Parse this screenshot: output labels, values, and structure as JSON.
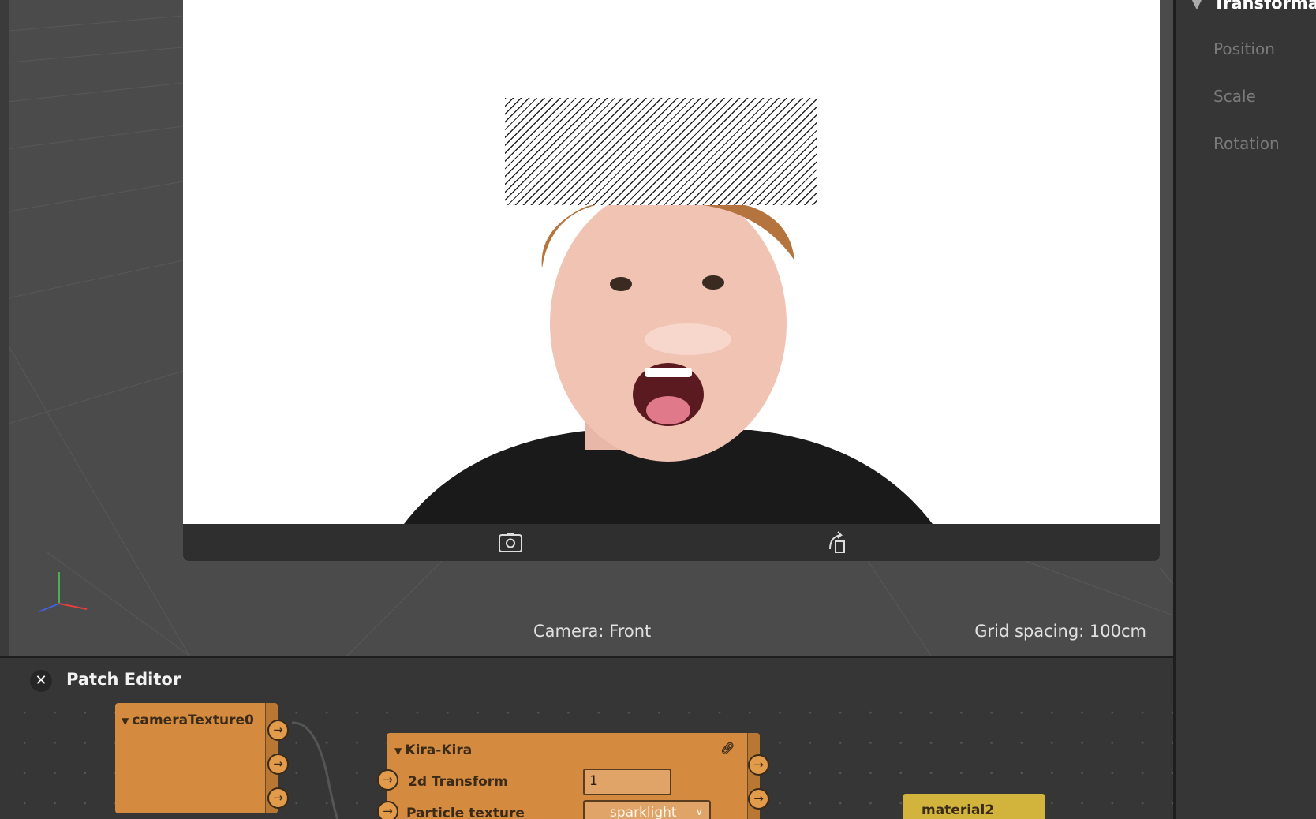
{
  "viewport": {
    "camera_label": "Camera: Front",
    "grid_spacing_label": "Grid spacing: 100cm",
    "toolbar_icons": [
      "flip-camera-icon",
      "rotate-device-icon"
    ]
  },
  "right_panel": {
    "section_title": "Transforma",
    "items": [
      "Position",
      "Scale",
      "Rotation"
    ]
  },
  "patch_editor": {
    "title": "Patch Editor",
    "close_label": "✕",
    "nodes": {
      "camera_texture": {
        "title": "cameraTexture0",
        "color": "#d48b40"
      },
      "kira": {
        "title": "Kira-Kira",
        "color": "#d48b40",
        "inputs": [
          {
            "label": "2d Transform",
            "value": "1"
          },
          {
            "label": "Particle texture",
            "value": "sparklight"
          }
        ]
      },
      "material": {
        "title": "material2",
        "color": "#d2b43c"
      }
    }
  }
}
